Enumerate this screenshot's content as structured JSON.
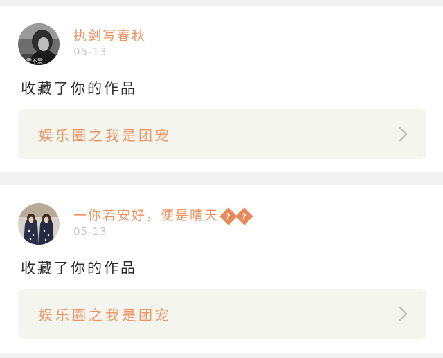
{
  "feed": {
    "items": [
      {
        "username": "执剑写春秋",
        "date": "05-13",
        "message": "收藏了你的作品",
        "work_title": "娱乐圈之我是团宠",
        "avatar_text": "爱不爱"
      },
      {
        "username": "一你若安好，便是晴天",
        "username_badges": [
          "?",
          "?"
        ],
        "date": "05-13",
        "message": "收藏了你的作品",
        "work_title": "娱乐圈之我是团宠"
      }
    ]
  },
  "colors": {
    "accent": "#f0915c",
    "page_bg": "#f2f2f2",
    "card_bg": "#ffffff",
    "link_bg": "#f5f5ef",
    "date": "#c8c8c8",
    "text": "#2b2b2b",
    "chevron": "#c0c0c0"
  },
  "icons": {
    "chevron": "chevron-right-icon"
  }
}
